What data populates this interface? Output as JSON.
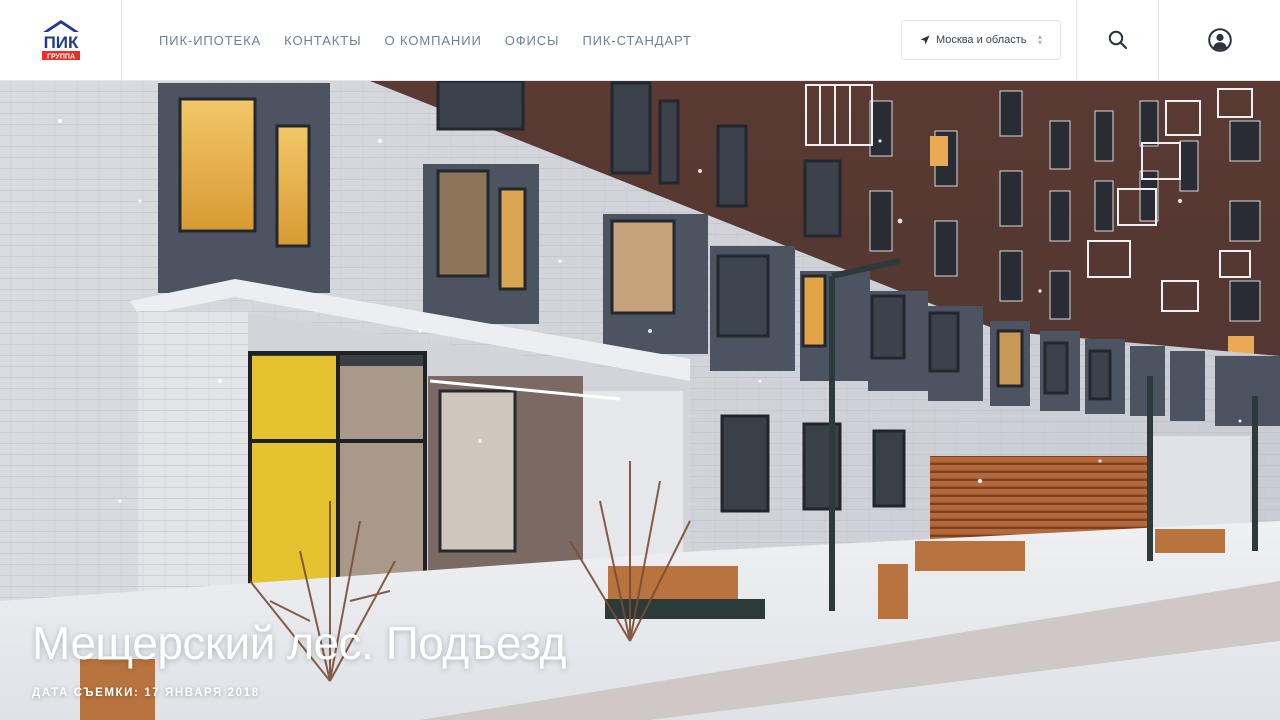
{
  "logo": {
    "line1": "ПИК",
    "line2": "ГРУППА"
  },
  "nav": {
    "items": [
      {
        "label": "ПИК-ИПОТЕКА"
      },
      {
        "label": "КОНТАКТЫ"
      },
      {
        "label": "О КОМПАНИИ"
      },
      {
        "label": "ОФИСЫ"
      },
      {
        "label": "ПИК-СТАНДАРТ"
      }
    ]
  },
  "region": {
    "label": "Москва и область",
    "icon": "location-arrow-icon"
  },
  "actions": {
    "search_icon": "search-icon",
    "user_icon": "user-icon"
  },
  "hero": {
    "title": "Мещерский лес. Подъезд",
    "date_prefix": "ДАТА СЪЕМКИ: ",
    "date_value": "17 ЯНВАРЯ 2018"
  },
  "colors": {
    "nav_text": "#6f8197",
    "logo_blue": "#1f3a8f",
    "logo_red": "#e4322b"
  }
}
